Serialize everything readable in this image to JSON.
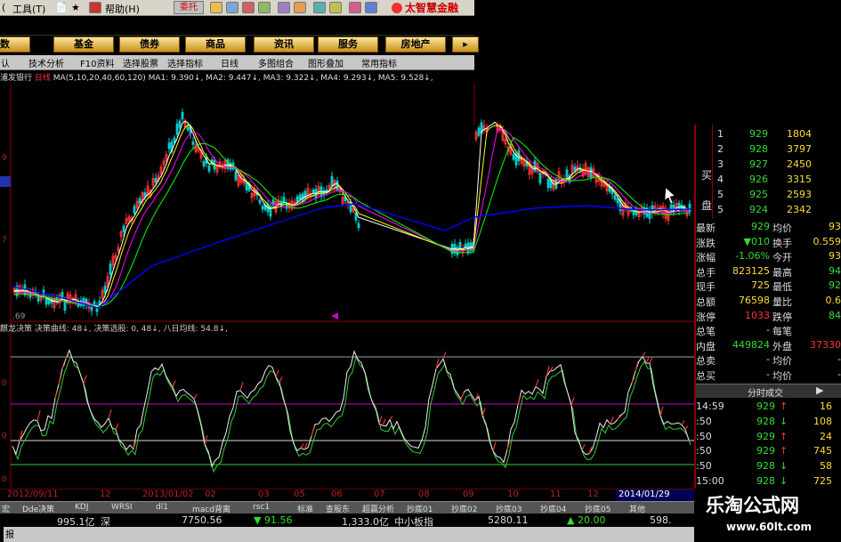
{
  "menu": [
    "工具(T)",
    "帮助(H)"
  ],
  "tuotuo": "委托",
  "brand": "太智慧金融",
  "nav": [
    "指数",
    "基金",
    "债券",
    "商品",
    "资讯",
    "服务",
    "房地产"
  ],
  "toolbar": [
    "认",
    "技术分析",
    "F10资料",
    "选择股票",
    "选择指标",
    "日线",
    "多图组合",
    "图形叠加",
    "常用指标"
  ],
  "stock": {
    "name": "浦发银行",
    "period": "日线"
  },
  "ma_line": "MA(5,10,20,40,60,120)  MA1: 9.390↓, MA2: 9.447↓, MA3: 9.322↓, MA4: 9.293↓, MA5: 9.528↓,",
  "osc_line": "麒龙决策  决策曲线: 48↓, 决策选股: 0, 48↓, 八日均线: 54.8↓,",
  "price_axis": [
    "9",
    "7",
    ".69"
  ],
  "osc_axis": [
    "0",
    "0",
    "0"
  ],
  "dates": [
    "2012/09/11",
    "12",
    "2013/01/02",
    "02",
    "03",
    "05",
    "06",
    "07",
    "08",
    "09",
    "10",
    "11",
    "12"
  ],
  "last_date": "2014/01/29",
  "tabs": [
    "宏",
    "Dde决策",
    "KDJ",
    "WRSI",
    "dl1",
    "macd背离",
    "rsc1",
    "标准",
    "查股东",
    "超赢分析",
    "抄底01",
    "抄底02",
    "抄底03",
    "抄底04",
    "抄底05",
    "其他"
  ],
  "status": {
    "left": "995.1亿",
    "mkt": "深",
    "idx": "7750.56",
    "chg": "▼ 91.56",
    "vol": "1,333.0亿",
    "board": "中小板指",
    "idx2": "5280.11",
    "chg2": "▲ 20.00",
    "val3": "598.",
    "bottom": "报"
  },
  "bids": [
    {
      "n": "1",
      "p": "929",
      "v": "1804"
    },
    {
      "n": "2",
      "p": "928",
      "v": "3797"
    },
    {
      "n": "3",
      "p": "927",
      "v": "2450"
    },
    {
      "n": "4",
      "p": "926",
      "v": "3315"
    },
    {
      "n": "5",
      "p": "925",
      "v": "2593"
    },
    {
      "n": "5",
      "p": "924",
      "v": "2342"
    }
  ],
  "bid_label": "买盘",
  "quote": [
    {
      "k": "最新",
      "v": "929",
      "k2": "均价",
      "v2": "93"
    },
    {
      "k": "涨跌",
      "v": "▼010",
      "k2": "换手",
      "v2": "0.559"
    },
    {
      "k": "涨幅",
      "v": "-1.06%",
      "k2": "今开",
      "v2": "93"
    },
    {
      "k": "总手",
      "v": "823125",
      "k2": "最高",
      "v2": "94"
    },
    {
      "k": "现手",
      "v": "725",
      "k2": "最低",
      "v2": "92"
    },
    {
      "k": "总额",
      "v": "76598",
      "k2": "量比",
      "v2": "0.6"
    },
    {
      "k": "涨停",
      "v": "1033",
      "k2": "跌停",
      "v2": "84"
    },
    {
      "k": "总笔",
      "v": "-",
      "k2": "每笔",
      "v2": ""
    },
    {
      "k": "内盘",
      "v": "449824",
      "k2": "外盘",
      "v2": "37330"
    },
    {
      "k": "总卖",
      "v": "-",
      "k2": "均价",
      "v2": "-"
    },
    {
      "k": "总买",
      "v": "-",
      "k2": "均价",
      "v2": "-"
    }
  ],
  "ticks_title": "分时成交",
  "ticks": [
    {
      "t": "14:59",
      "p": "929",
      "a": "↑",
      "v": "16"
    },
    {
      "t": ":50",
      "p": "928",
      "a": "↓",
      "v": "108"
    },
    {
      "t": ":50",
      "p": "929",
      "a": "↑",
      "v": "24"
    },
    {
      "t": ":50",
      "p": "929",
      "a": "↑",
      "v": "745"
    },
    {
      "t": ":50",
      "p": "928",
      "a": "↓",
      "v": "58"
    },
    {
      "t": "15:00",
      "p": "928",
      "a": "↓",
      "v": "725"
    },
    {
      "t": ":05",
      "p": "929",
      "a": "↑",
      "v": ""
    }
  ],
  "promo": {
    "title": "乐淘公式网",
    "url": "www.60lt.com"
  },
  "colors": {
    "ma1": "#ffffff",
    "ma2": "#ffff00",
    "ma3": "#ff00ff",
    "ma4": "#00ff00",
    "ma5": "#0000ff",
    "up": "#ff3333",
    "down": "#00cccc"
  }
}
